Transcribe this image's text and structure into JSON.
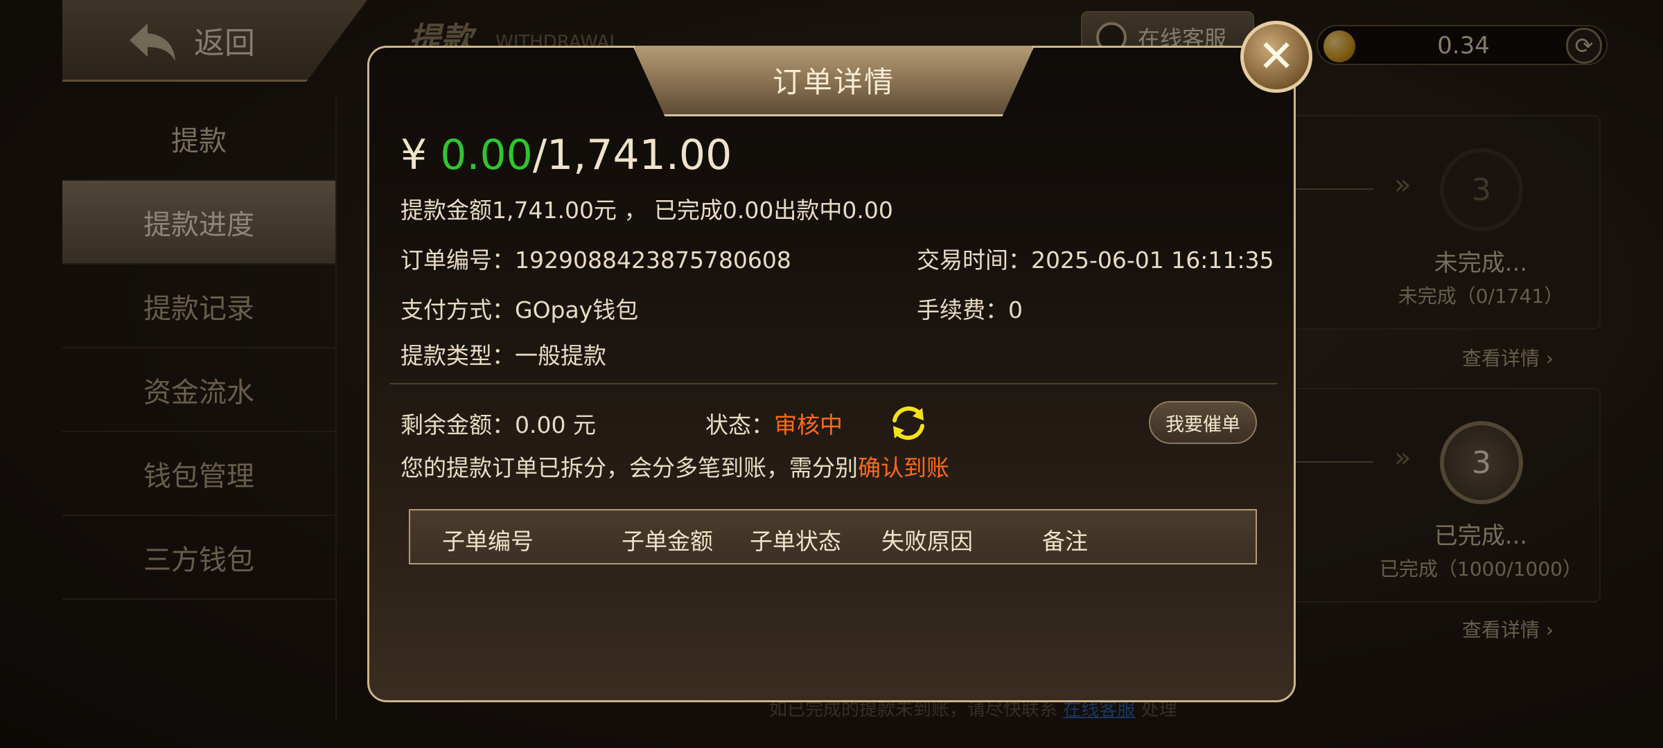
{
  "header": {
    "back_label": "返回",
    "page_title": "提款",
    "page_title_en": "WITHDRAWAL",
    "service_label": "在线客服",
    "balance": "0.34"
  },
  "sidebar": {
    "items": [
      {
        "label": "提款"
      },
      {
        "label": "提款进度"
      },
      {
        "label": "提款记录"
      },
      {
        "label": "资金流水"
      },
      {
        "label": "钱包管理"
      },
      {
        "label": "三方钱包"
      }
    ]
  },
  "cards": [
    {
      "step": "3",
      "title": "未完成...",
      "subtitle": "未完成（0/1741）",
      "detail_label": "查看详情"
    },
    {
      "step": "3",
      "title": "已完成...",
      "subtitle": "已完成（1000/1000）",
      "detail_label": "查看详情"
    }
  ],
  "footer": {
    "note_prefix": "如已完成的提款未到账，请尽快联系",
    "link": "在线客服",
    "note_suffix": "处理"
  },
  "dialog": {
    "title": "订单详情",
    "currency": "¥ ",
    "completed_amount": "0.00",
    "total_amount": "/1,741.00",
    "summary": "提款金额1,741.00元 ， 已完成0.00出款中0.00",
    "order_no_label": "订单编号：",
    "order_no": "1929088423875780608",
    "trade_time_label": "交易时间：",
    "trade_time": "2025-06-01 16:11:35",
    "pay_method_label": "支付方式：",
    "pay_method": "GOpay钱包",
    "fee_label": "手续费：",
    "fee": "0",
    "type_label": "提款类型：",
    "type": "一般提款",
    "remaining_label": "剩余金额：",
    "remaining": "0.00 元",
    "status_label": "状态：",
    "status": "审核中",
    "status_color": "#ff6a1a",
    "urge_button": "我要催单",
    "split_note": "您的提款订单已拆分，会分多笔到账，需分别",
    "confirm_link": "确认到账",
    "table_headers": [
      "子单编号",
      "子单金额",
      "子单状态",
      "失败原因",
      "备注"
    ]
  }
}
